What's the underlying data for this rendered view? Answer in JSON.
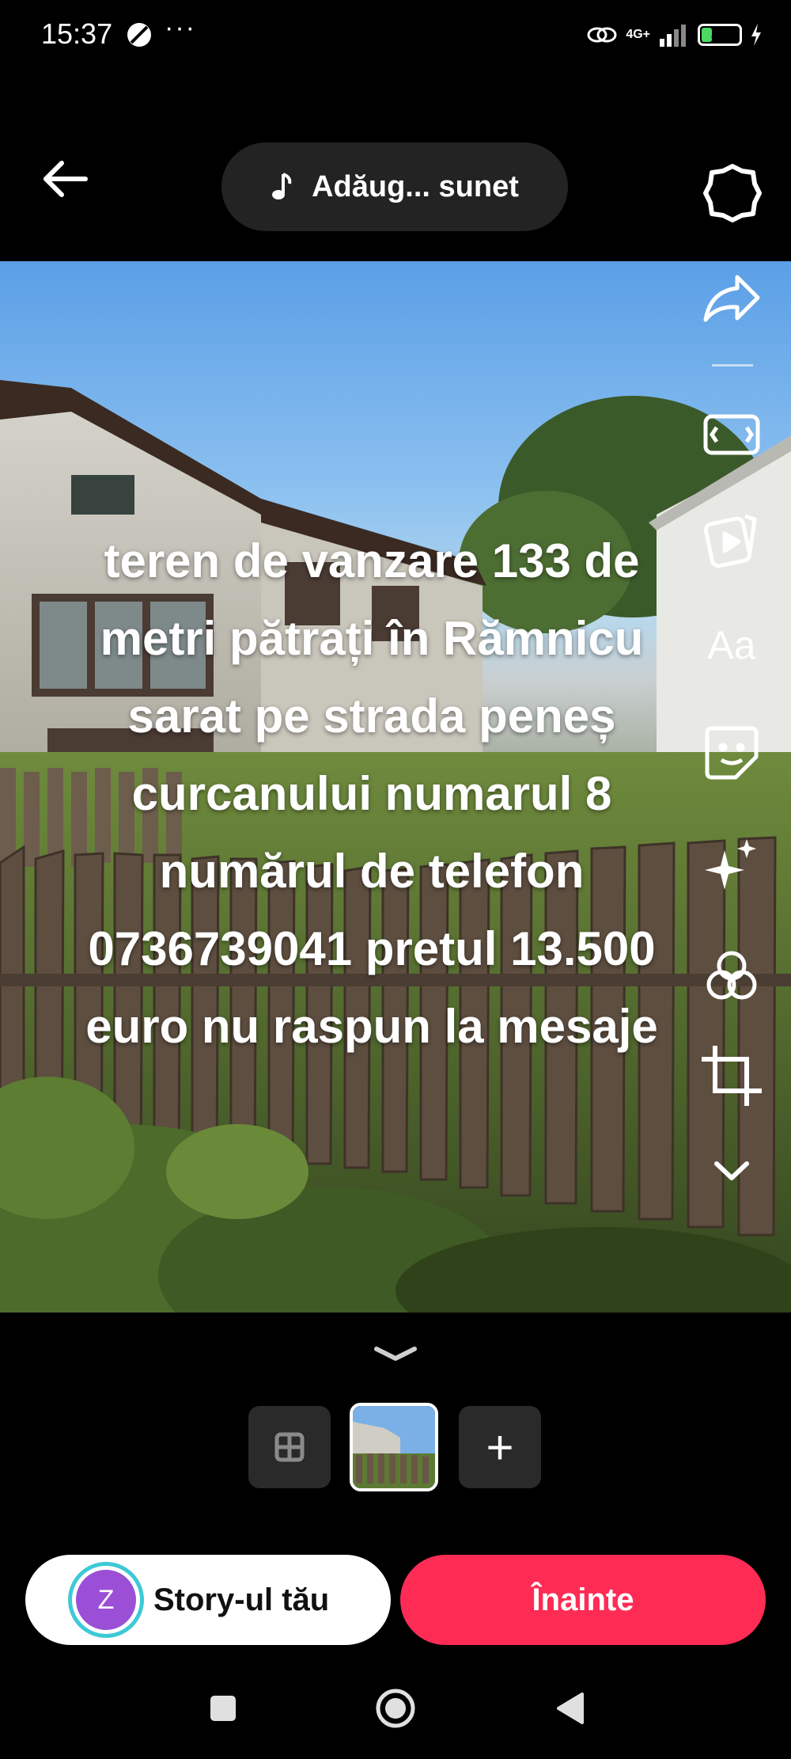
{
  "status_bar": {
    "time": "15:37",
    "more": "···",
    "network": "4G+",
    "battery": "28",
    "battery_level": 0.28
  },
  "top_bar": {
    "sound_label": "Adăug... sunet"
  },
  "overlay": {
    "text": "teren de vanzare 133 de metri pătrați în Rămnicu sarat pe strada peneș curcanului numarul 8 numărul de telefon 0736739041 pretul 13.500 euro nu raspun la mesaje"
  },
  "toolbar": {
    "items": [
      "share-icon",
      "aspect-ratio-icon",
      "video-icon",
      "text-icon",
      "sticker-icon",
      "effects-icon",
      "filters-icon",
      "crop-icon",
      "chevron-down-icon"
    ],
    "text_tool": "Aa"
  },
  "bottom": {
    "add_symbol": "+",
    "story_avatar_letter": "Z",
    "story_label": "Story-ul tău",
    "next_label": "Înainte"
  },
  "colors": {
    "accent": "#fe2c55",
    "avatar": "#9b4fd6",
    "avatar_ring": "#3ec9d6"
  }
}
